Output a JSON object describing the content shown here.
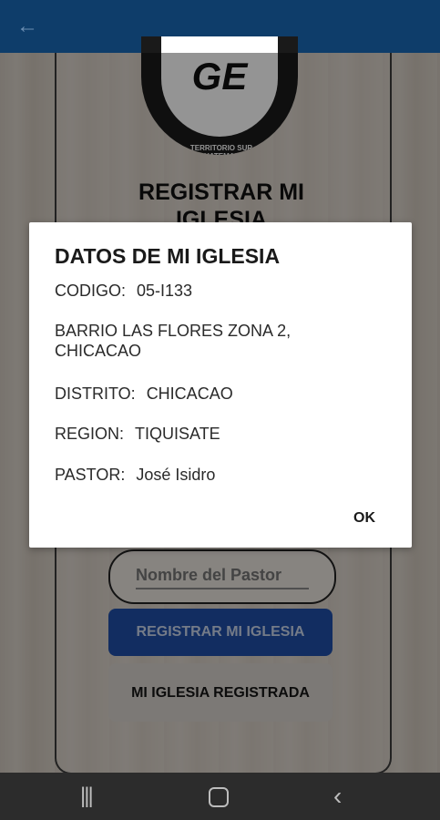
{
  "appbar": {
    "back_icon": "arrow-left-icon"
  },
  "logo": {
    "initials": "GE",
    "ring_text": "TERRITORIO SUR GUATEMALA"
  },
  "page": {
    "title": "REGISTRAR MI IGLESIA"
  },
  "form": {
    "pastor_placeholder": "Nombre del Pastor",
    "register_button": "REGISTRAR MI IGLESIA",
    "registered_button": "MI IGLESIA REGISTRADA"
  },
  "dialog": {
    "title": "DATOS DE MI IGLESIA",
    "codigo_label": "CODIGO:",
    "codigo_value": "05-I133",
    "address_line1": "BARRIO LAS FLORES ZONA 2,",
    "address_line2": "CHICACAO",
    "distrito_label": "DISTRITO:",
    "distrito_value": "CHICACAO",
    "region_label": "REGION:",
    "region_value": "TIQUISATE",
    "pastor_label": "PASTOR:",
    "pastor_value": "José Isidro",
    "ok_button": "OK"
  },
  "navbar": {
    "recents_icon": "recents-icon",
    "home_icon": "home-icon",
    "back_icon": "back-chevron-icon"
  },
  "colors": {
    "appbar": "#0e3d6a",
    "primary_button": "#1f4fa8"
  }
}
